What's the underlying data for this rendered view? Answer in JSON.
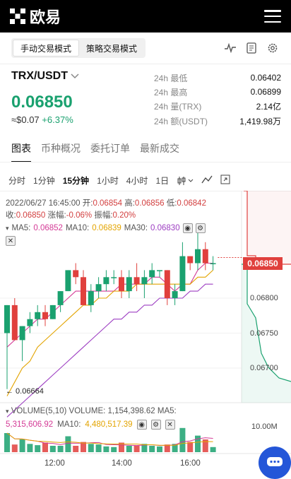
{
  "header": {
    "logo_text": "欧易",
    "logo_icon": "okx-x-icon",
    "menu_icon": "hamburger-menu-icon"
  },
  "mode_tabs": [
    "手动交易模式",
    "策略交易模式"
  ],
  "mode_icons": [
    "activity-icon",
    "document-icon",
    "gear-icon"
  ],
  "pair": {
    "symbol": "TRX/USDT",
    "price": "0.06850",
    "fiat": "≈$0.07",
    "change": "+6.37%"
  },
  "stats": [
    {
      "label": "24h 最低",
      "value": "0.06402"
    },
    {
      "label": "24h 最高",
      "value": "0.06899"
    },
    {
      "label": "24h 量(TRX)",
      "value": "2.14亿"
    },
    {
      "label": "24h 额(USDT)",
      "value": "1,419.98万"
    }
  ],
  "tabs": [
    "图表",
    "币种概况",
    "委托订单",
    "最新成交"
  ],
  "intervals": [
    "分时",
    "1分钟",
    "15分钟",
    "1小时",
    "4小时",
    "1日"
  ],
  "ohlc": {
    "date": "2022/06/27 16:45:00",
    "open_label": "开:",
    "open": "0.06854",
    "high_label": "高:",
    "high": "0.06856",
    "low_label": "低:",
    "low": "0.06842",
    "close_label": "收:",
    "close": "0.06850",
    "chg_label": "涨幅:",
    "chg": "-0.06%",
    "amp_label": "振幅:",
    "amp": "0.20%"
  },
  "ma": {
    "ma5_label": "MA5:",
    "ma5": "0.06852",
    "ma10_label": "MA10:",
    "ma10": "0.06839",
    "ma30_label": "MA30:",
    "ma30": "0.06830"
  },
  "price_tag": "0.06850",
  "y_labels": [
    "0.06800",
    "0.06750",
    "0.06700"
  ],
  "low_label": "← 0.06664",
  "volume": {
    "label": "VOLUME(5,10)",
    "vol_label": "VOLUME:",
    "vol": "1,154,398.62",
    "ma5_label": "MA5:",
    "ma5": "5,315,606.92",
    "ma10_label": "MA10:",
    "ma10": "4,480,517.39",
    "y_label": "10.00M"
  },
  "x_labels": [
    "12:00",
    "14:00",
    "16:00"
  ],
  "colors": {
    "up": "#1aa16f",
    "down": "#e0403d",
    "ma5": "#d43a96",
    "ma10": "#e3a400",
    "ma30": "#9d3ec2"
  },
  "chart_data": {
    "type": "candlestick",
    "title": "TRX/USDT 15分钟",
    "y_ticks": [
      0.068,
      0.0675,
      0.067
    ],
    "x_ticks": [
      "12:00",
      "14:00",
      "16:00"
    ],
    "candles": [
      {
        "o": 0.0675,
        "h": 0.0679,
        "l": 0.0667,
        "c": 0.0679
      },
      {
        "o": 0.0679,
        "h": 0.068,
        "l": 0.0674,
        "c": 0.0674
      },
      {
        "o": 0.0674,
        "h": 0.0676,
        "l": 0.0671,
        "c": 0.0676
      },
      {
        "o": 0.0676,
        "h": 0.0678,
        "l": 0.0675,
        "c": 0.0677
      },
      {
        "o": 0.0677,
        "h": 0.0679,
        "l": 0.0676,
        "c": 0.0678
      },
      {
        "o": 0.0678,
        "h": 0.0679,
        "l": 0.0676,
        "c": 0.0677
      },
      {
        "o": 0.0677,
        "h": 0.0679,
        "l": 0.0677,
        "c": 0.0679
      },
      {
        "o": 0.0679,
        "h": 0.0681,
        "l": 0.0678,
        "c": 0.0681
      },
      {
        "o": 0.0681,
        "h": 0.0684,
        "l": 0.0681,
        "c": 0.0684
      },
      {
        "o": 0.0684,
        "h": 0.0685,
        "l": 0.0682,
        "c": 0.0683
      },
      {
        "o": 0.0683,
        "h": 0.0684,
        "l": 0.0679,
        "c": 0.0679
      },
      {
        "o": 0.0679,
        "h": 0.0682,
        "l": 0.0678,
        "c": 0.0681
      },
      {
        "o": 0.0681,
        "h": 0.0683,
        "l": 0.068,
        "c": 0.0682
      },
      {
        "o": 0.0682,
        "h": 0.0684,
        "l": 0.0681,
        "c": 0.0683
      },
      {
        "o": 0.0683,
        "h": 0.0684,
        "l": 0.0682,
        "c": 0.0683
      },
      {
        "o": 0.0683,
        "h": 0.0684,
        "l": 0.068,
        "c": 0.0681
      },
      {
        "o": 0.0681,
        "h": 0.0684,
        "l": 0.068,
        "c": 0.0683
      },
      {
        "o": 0.0683,
        "h": 0.0685,
        "l": 0.0681,
        "c": 0.0682
      },
      {
        "o": 0.0682,
        "h": 0.0684,
        "l": 0.068,
        "c": 0.0683
      },
      {
        "o": 0.0683,
        "h": 0.0685,
        "l": 0.0682,
        "c": 0.0684
      },
      {
        "o": 0.0684,
        "h": 0.0684,
        "l": 0.0683,
        "c": 0.0684
      },
      {
        "o": 0.0684,
        "h": 0.0684,
        "l": 0.0679,
        "c": 0.068
      },
      {
        "o": 0.068,
        "h": 0.0682,
        "l": 0.0679,
        "c": 0.0681
      },
      {
        "o": 0.0681,
        "h": 0.0688,
        "l": 0.0681,
        "c": 0.0686
      },
      {
        "o": 0.0686,
        "h": 0.0686,
        "l": 0.0684,
        "c": 0.0685
      },
      {
        "o": 0.0685,
        "h": 0.069,
        "l": 0.0684,
        "c": 0.0687
      },
      {
        "o": 0.0687,
        "h": 0.0688,
        "l": 0.0684,
        "c": 0.0685
      },
      {
        "o": 0.0685,
        "h": 0.0686,
        "l": 0.0684,
        "c": 0.0685
      }
    ],
    "ma5": [
      0.0673,
      0.0674,
      0.0675,
      0.0676,
      0.0677,
      0.0677,
      0.0678,
      0.0679,
      0.068,
      0.0681,
      0.0681,
      0.0681,
      0.0681,
      0.0681,
      0.0681,
      0.0682,
      0.0682,
      0.0682,
      0.0682,
      0.0683,
      0.0683,
      0.0682,
      0.0681,
      0.0682,
      0.0682,
      0.0684,
      0.0685,
      0.0685
    ],
    "ma10": [
      0.0666,
      0.0668,
      0.067,
      0.0671,
      0.0673,
      0.0674,
      0.0675,
      0.0676,
      0.0677,
      0.0678,
      0.0679,
      0.0679,
      0.068,
      0.068,
      0.0681,
      0.0681,
      0.0681,
      0.0682,
      0.0682,
      0.0682,
      0.0682,
      0.0682,
      0.0682,
      0.0682,
      0.0682,
      0.0683,
      0.0683,
      0.0684
    ],
    "ma30": [
      0.0663,
      0.0664,
      0.0665,
      0.0666,
      0.0667,
      0.0668,
      0.0669,
      0.067,
      0.0671,
      0.0672,
      0.0673,
      0.0674,
      0.0675,
      0.0676,
      0.0677,
      0.0677,
      0.0678,
      0.0678,
      0.0679,
      0.0679,
      0.068,
      0.068,
      0.068,
      0.068,
      0.0681,
      0.0681,
      0.0682,
      0.0682
    ],
    "volume": [
      3.0,
      1.2,
      2.0,
      1.3,
      1.1,
      1.5,
      1.0,
      1.0,
      2.5,
      1.0,
      1.6,
      1.3,
      1.2,
      0.9,
      0.8,
      1.5,
      1.0,
      1.0,
      1.3,
      1.0,
      0.9,
      1.2,
      1.3,
      3.8,
      1.6,
      2.6,
      2.0,
      0.8
    ],
    "volume_ylabel": "10.00M"
  }
}
